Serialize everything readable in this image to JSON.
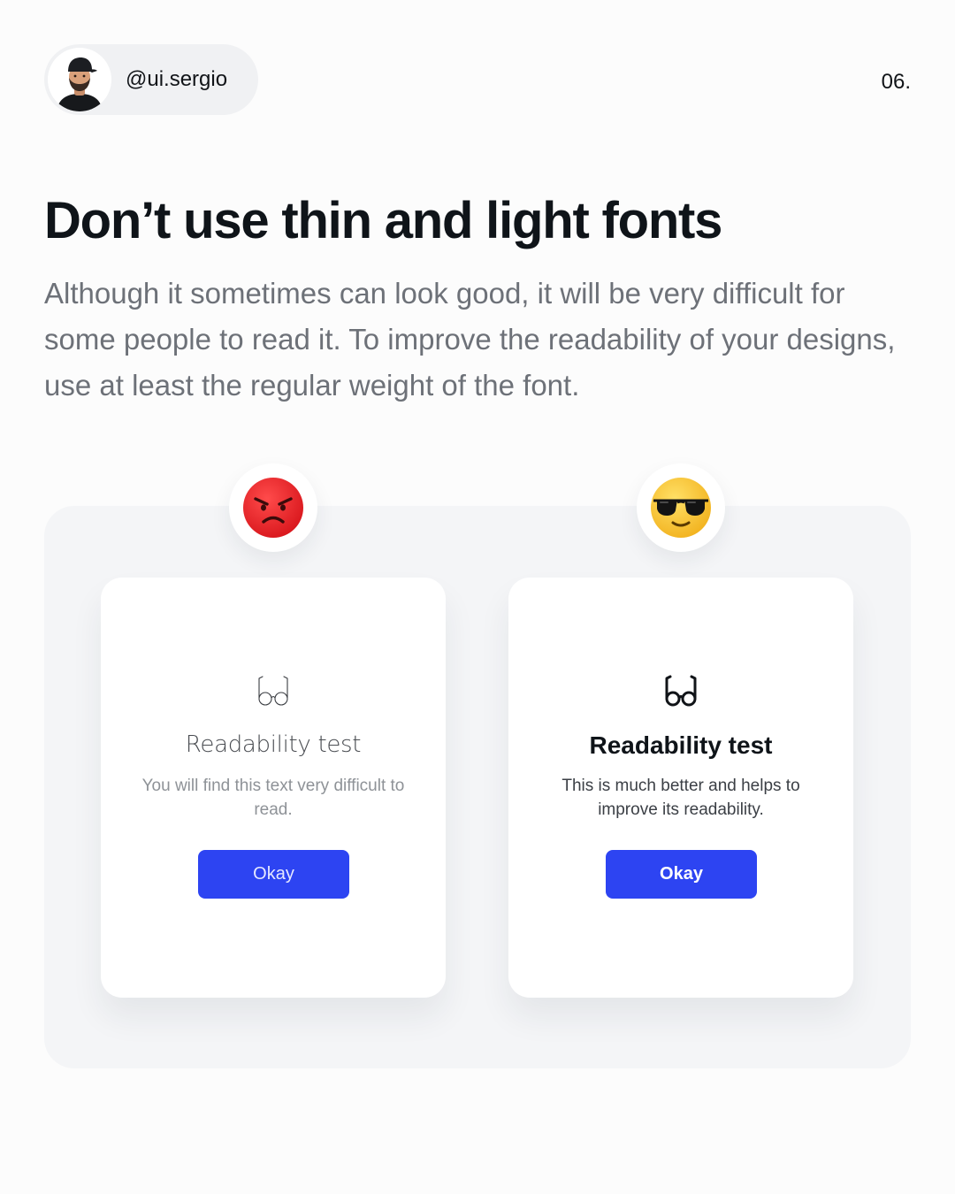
{
  "header": {
    "handle": "@ui.sergio",
    "page_number": "06."
  },
  "headline": {
    "title": "Don’t use thin and light fonts",
    "subtitle": "Although it sometimes can look good, it will be very difficult for some people to read it. To improve the readability of your designs, use at least the regular weight of the font."
  },
  "comparison": {
    "bad": {
      "emoji": "angry-face-icon",
      "icon": "glasses-icon",
      "title": "Readability test",
      "body": "You will find this text very difficult to read.",
      "button_label": "Okay"
    },
    "good": {
      "emoji": "sunglasses-face-icon",
      "icon": "glasses-icon",
      "title": "Readability test",
      "body": "This is much better and helps to improve its readability.",
      "button_label": "Okay"
    }
  },
  "colors": {
    "accent_button": "#2d44f2",
    "angry_emoji": "#e8262b",
    "cool_emoji": "#f7c533",
    "panel_background": "#f4f5f7"
  }
}
